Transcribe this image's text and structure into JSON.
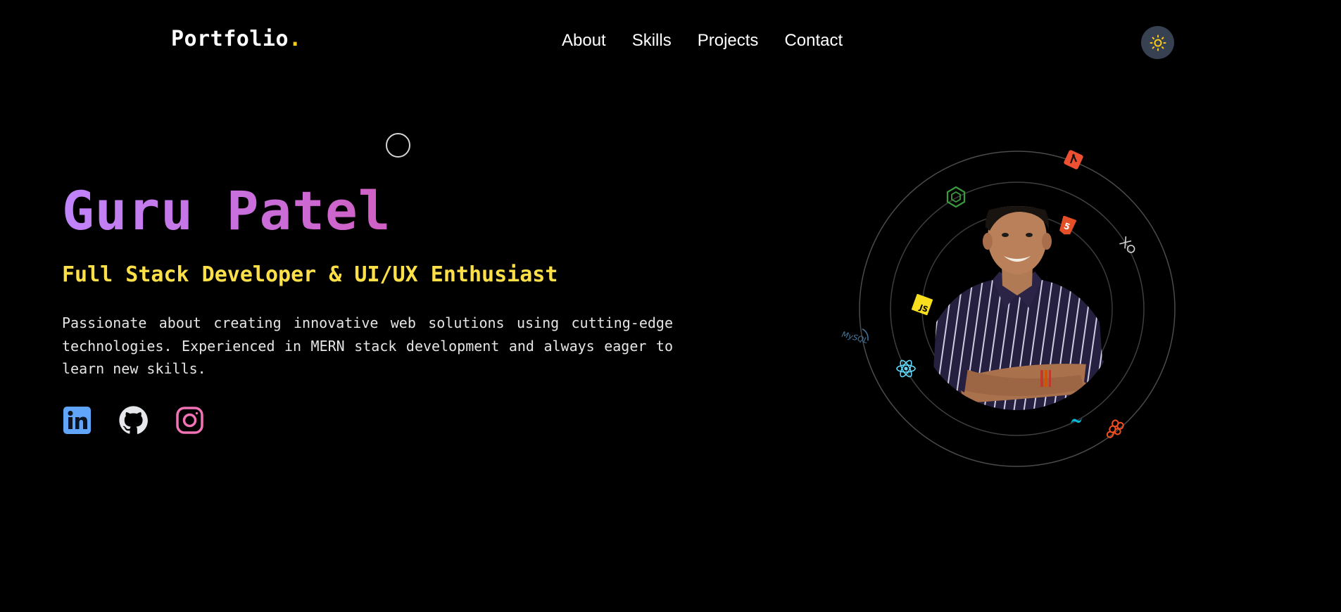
{
  "nav": {
    "logo_text": "Portfolio",
    "logo_dot": ".",
    "links": [
      "About",
      "Skills",
      "Projects",
      "Contact"
    ],
    "theme_icon": "sun-icon"
  },
  "hero": {
    "name": "Guru Patel",
    "role": "Full Stack Developer & UI/UX Enthusiast",
    "description": "Passionate about creating innovative web solutions using cutting-edge technologies. Experienced in MERN stack development and always eager to learn new skills."
  },
  "socials": [
    {
      "name": "linkedin-icon",
      "color": "#60a5fa"
    },
    {
      "name": "github-icon",
      "color": "#e5e7eb"
    },
    {
      "name": "instagram-icon",
      "color": "#f472b6"
    }
  ],
  "orbit_icons": [
    {
      "name": "git-icon",
      "color": "#f05032"
    },
    {
      "name": "nodejs-icon",
      "color": "#3c9a3f"
    },
    {
      "name": "html5-icon",
      "color": "#e34f26"
    },
    {
      "name": "express-icon",
      "color": "#d4d4d4"
    },
    {
      "name": "javascript-icon",
      "color": "#f7df1e"
    },
    {
      "name": "mysql-icon",
      "color": "#4479a1",
      "text": "MySQL"
    },
    {
      "name": "react-icon",
      "color": "#61dafb"
    },
    {
      "name": "tailwind-icon",
      "color": "#06b6d4"
    },
    {
      "name": "figma-icon",
      "color": "#f24e1e"
    }
  ],
  "colors": {
    "background": "#000000",
    "accent_yellow": "#facc15",
    "name_gradient_start": "#c084fc",
    "name_gradient_end": "#d05fc2",
    "role_color": "#fde047",
    "theme_button_bg": "#374151"
  }
}
